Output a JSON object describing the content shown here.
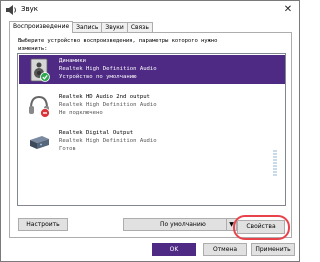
{
  "window": {
    "title": "Звук"
  },
  "tabs": [
    {
      "label": "Воспроизведение"
    },
    {
      "label": "Запись"
    },
    {
      "label": "Звуки"
    },
    {
      "label": "Связь"
    }
  ],
  "instruction": {
    "line1": "Выберите устройство воспроизведения, параметры которого нужно",
    "line2": "изменить:"
  },
  "devices": [
    {
      "name": "Динамики",
      "driver": "Realtek High Definition Audio",
      "status": "Устройство по умолчанию",
      "icon": "speaker-icon"
    },
    {
      "name": "Realtek HD Audio 2nd output",
      "driver": "Realtek High Definition Audio",
      "status": "Не подключено",
      "icon": "headphones-icon"
    },
    {
      "name": "Realtek Digital Output",
      "driver": "Realtek High Definition Audio",
      "status": "Готов",
      "icon": "digital-output-icon"
    }
  ],
  "buttons": {
    "configure": "Настроить",
    "set_default": "По умолчанию",
    "properties": "Свойства",
    "ok": "OK",
    "cancel": "Отмена",
    "apply": "Применить"
  },
  "colors": {
    "selection": "#4e2a84",
    "highlight_ring": "#e8434b",
    "default_check": "#2fa84f",
    "disconnected_badge": "#d9343a"
  }
}
